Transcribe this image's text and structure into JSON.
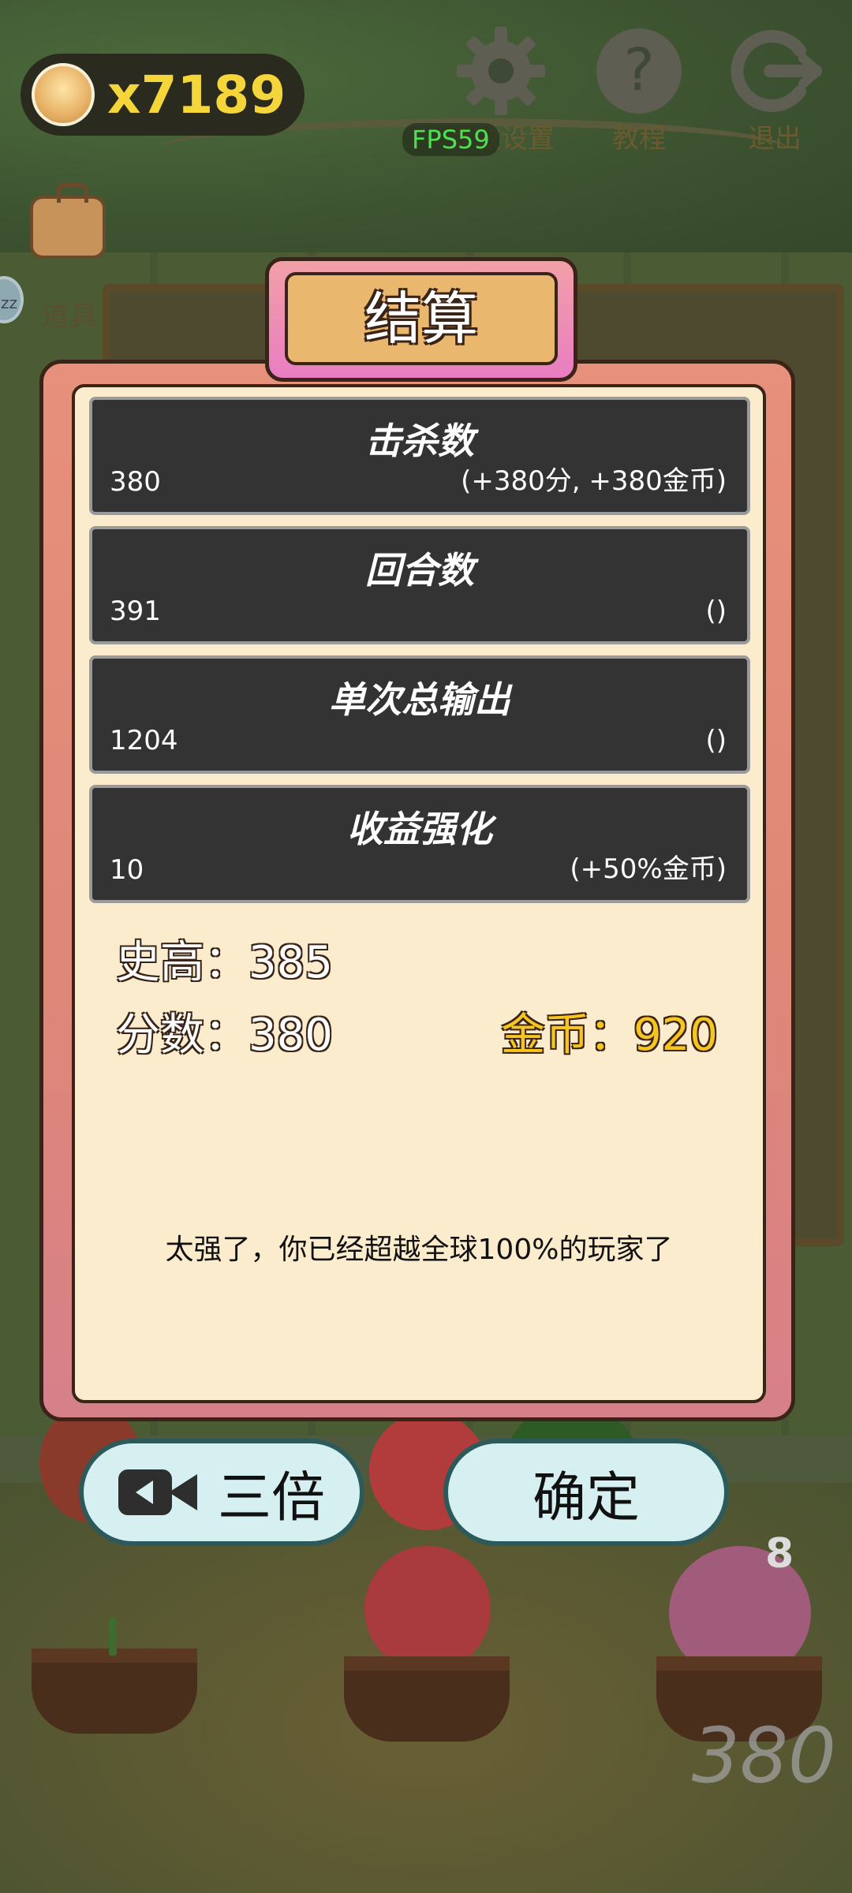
{
  "hud": {
    "coin_count": "x7189",
    "fps": "FPS59",
    "settings_label": "音效设置",
    "tutorial_label": "教程",
    "exit_label": "退出",
    "tool_label": "道具",
    "sleep_badge": "zz"
  },
  "dialog": {
    "title": "结算",
    "stats": [
      {
        "name": "击杀数",
        "value": "380",
        "bonus": "(+380分, +380金币)"
      },
      {
        "name": "回合数",
        "value": "391",
        "bonus": "()"
      },
      {
        "name": "单次总输出",
        "value": "1204",
        "bonus": "()"
      },
      {
        "name": "收益强化",
        "value": "10",
        "bonus": "(+50%金币)"
      }
    ],
    "best_label": "史高：385",
    "score_label": "分数：380",
    "gold_label": "金币：920",
    "rank_message": "太强了，你已经超越全球100%的玩家了"
  },
  "buttons": {
    "triple_label": "三倍",
    "confirm_label": "确定"
  },
  "background": {
    "pot_level": "8",
    "score_watermark": "380"
  },
  "colors": {
    "coin_text": "#f5d63a",
    "gold_text": "#f7c520",
    "fps_text": "#4ee04e",
    "dialog_frame": "#e7907b",
    "dialog_panel": "#fbeccd",
    "stat_row": "#333333",
    "button_fill": "#d6eff0"
  }
}
